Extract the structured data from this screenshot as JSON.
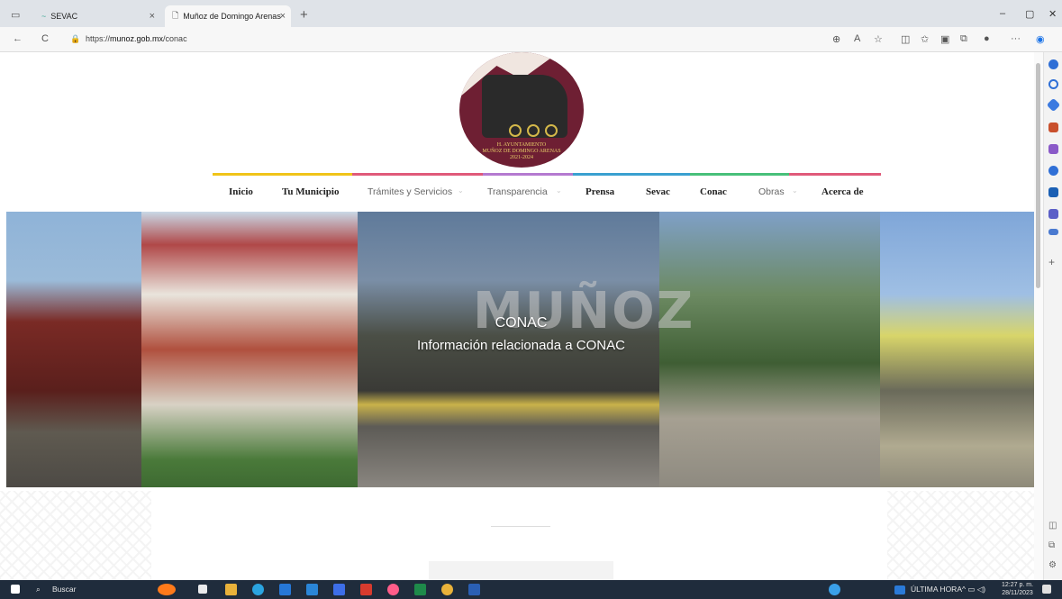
{
  "browser": {
    "tabs": [
      {
        "label": "SEVAC"
      },
      {
        "label": "Muñoz de Domingo Arenas"
      }
    ],
    "new_tab_label": "+",
    "close_label": "×",
    "url_prefix": "https://",
    "url_host": "munoz.gob.mx",
    "url_path": "/conac",
    "window_controls": {
      "minimize": "–",
      "restore": "▢",
      "close": "✕"
    },
    "nav_icons": {
      "back": "←",
      "refresh": "C"
    }
  },
  "site": {
    "logo_lines": [
      "H. AYUNTAMIENTO",
      "MUÑOZ DE DOMINGO ARENAS",
      "2021-2024"
    ],
    "nav": [
      {
        "label": "Inicio",
        "style": "bold",
        "color": "#f0c419"
      },
      {
        "label": "Tu Municipio",
        "style": "bold",
        "color": "#f0c419"
      },
      {
        "label": "Trámites y Servicios",
        "style": "light",
        "color": "#e05a7a"
      },
      {
        "label": "Transparencia",
        "style": "light",
        "color": "#b47ad0"
      },
      {
        "label": "Prensa",
        "style": "bold",
        "color": "#3aa0d0"
      },
      {
        "label": "Sevac",
        "style": "bold",
        "color": "#3aa0d0"
      },
      {
        "label": "Conac",
        "style": "bold",
        "color": "#48c07a"
      },
      {
        "label": "Obras",
        "style": "light",
        "color": "#48c07a"
      },
      {
        "label": "Acerca de",
        "style": "bold",
        "color": "#e05a7a"
      }
    ],
    "hero": {
      "title": "CONAC",
      "subtitle": "Información relacionada a CONAC",
      "watermark": "MUÑOZ"
    }
  },
  "taskbar": {
    "search_label": "Buscar",
    "news_label": "ÚLTIMA HORA",
    "time": "12:27 p. m.",
    "date": "28/11/2023"
  },
  "colors": {
    "logo_bg": "#6e1f33",
    "logo_gold": "#e8cf6a",
    "taskbar_bg": "#1f2c3c"
  }
}
